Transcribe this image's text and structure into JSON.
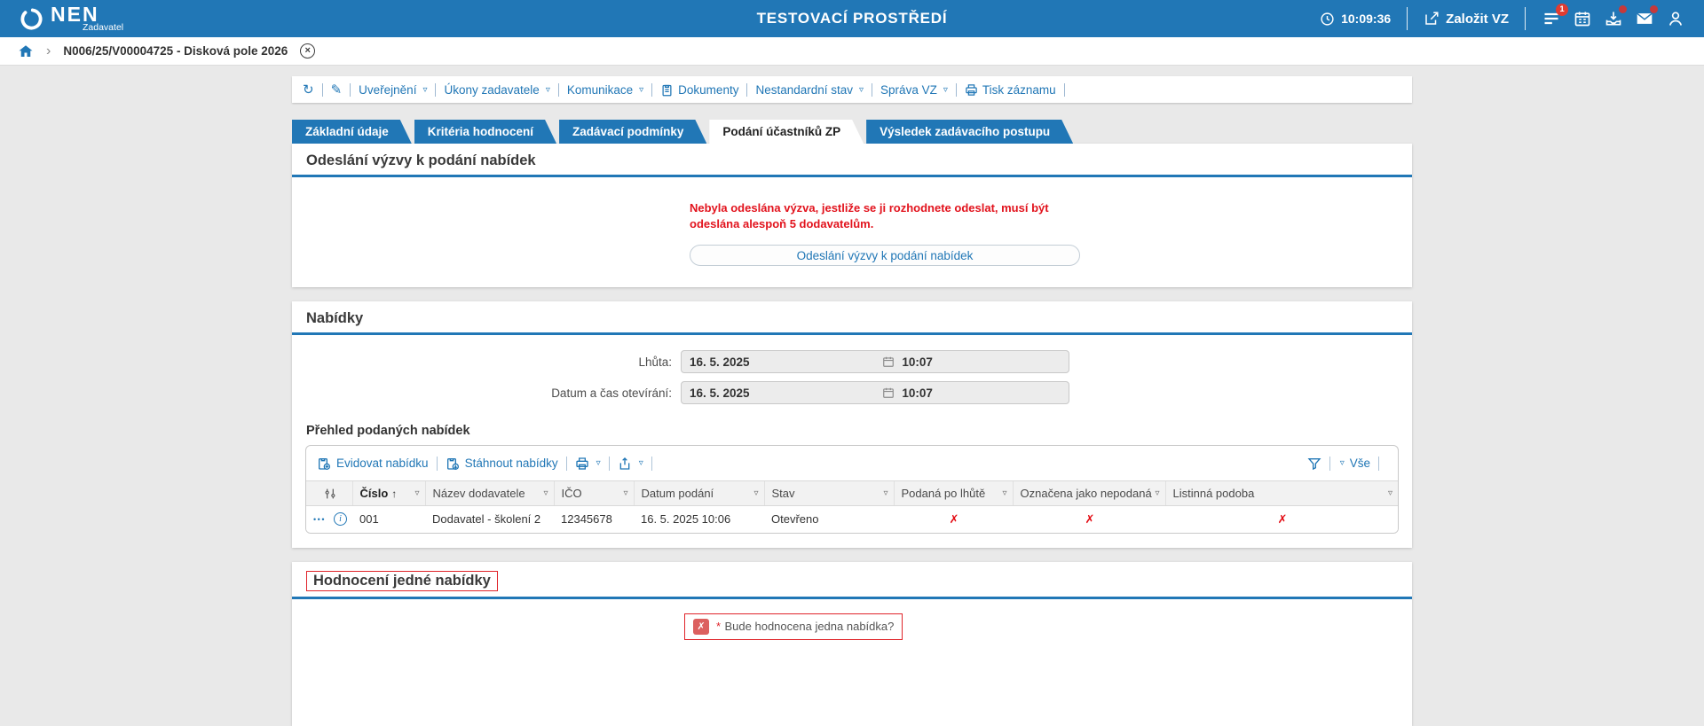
{
  "header": {
    "logo_text": "NEN",
    "logo_subtitle": "Zadavatel",
    "environment_title": "TESTOVACÍ PROSTŘEDÍ",
    "clock_time": "10:09:36",
    "create_vz_label": "Založit VZ",
    "menu_badge_count": "1"
  },
  "breadcrumb": {
    "record_label": "N006/25/V00004725 - Disková pole 2026"
  },
  "command_bar": {
    "items": [
      "Uveřejnění",
      "Úkony zadavatele",
      "Komunikace",
      "Dokumenty",
      "Nestandardní stav",
      "Správa VZ",
      "Tisk záznamu"
    ]
  },
  "tabs": [
    {
      "label": "Základní údaje"
    },
    {
      "label": "Kritéria hodnocení"
    },
    {
      "label": "Zadávací podmínky"
    },
    {
      "label": "Podání účastníků ZP"
    },
    {
      "label": "Výsledek zadávacího postupu"
    }
  ],
  "vyzva_section": {
    "title": "Odeslání výzvy k podání nabídek",
    "warning": "Nebyla odeslána výzva, jestliže se ji rozhodnete odeslat, musí být odeslána alespoň 5 dodavatelům.",
    "send_button": "Odeslání výzvy k podání nabídek"
  },
  "nabidky_section": {
    "title": "Nabídky",
    "fields": [
      {
        "label": "Lhůta:",
        "date": "16. 5. 2025",
        "time": "10:07"
      },
      {
        "label": "Datum a čas otevírání:",
        "date": "16. 5. 2025",
        "time": "10:07"
      }
    ],
    "table": {
      "title": "Přehled podaných nabídek",
      "toolbar": {
        "evidovat": "Evidovat nabídku",
        "stahnout": "Stáhnout nabídky",
        "filter_all": "Vše"
      },
      "columns": [
        "Číslo",
        "Název dodavatele",
        "IČO",
        "Datum podání",
        "Stav",
        "Podaná po lhůtě",
        "Označena jako nepodaná",
        "Listinná podoba"
      ],
      "rows": [
        {
          "cislo": "001",
          "nazev_dodavatele": "Dodavatel - školení 2",
          "ico": "12345678",
          "datum_podani": "16. 5. 2025 10:06",
          "stav": "Otevřeno",
          "podana_po_lhute": "✗",
          "oznacena_jako_nepodana": "✗",
          "listinna_podoba": "✗"
        }
      ]
    }
  },
  "hodnoceni_section": {
    "title": "Hodnocení jedné nabídky",
    "error_prefix": "*",
    "error_text": "Bude hodnocena jedna nabídka?"
  },
  "icons": {
    "refresh": "↻",
    "pencil": "✎",
    "caret_down": "▿",
    "sort_asc": "↑",
    "chevron_right": "›",
    "close": "×",
    "row_menu": "•••",
    "info": "i",
    "error_cross": "✗"
  },
  "colors": {
    "header_blue": "#2177b6",
    "accent_blue": "#2177b6",
    "error_red": "#e0242a",
    "badge_red": "#e03c31"
  }
}
